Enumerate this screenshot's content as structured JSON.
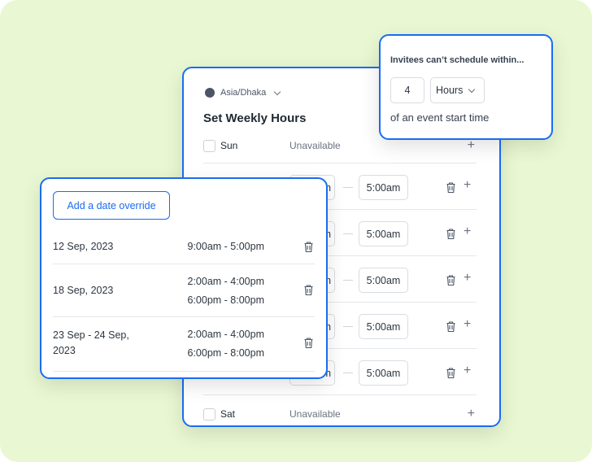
{
  "colors": {
    "accent": "#1a6cf2",
    "background": "#e9f8d2"
  },
  "weekly": {
    "timezone": "Asia/Dhaka",
    "title": "Set Weekly Hours",
    "sun": {
      "day": "Sun",
      "status": "Unavailable"
    },
    "sat": {
      "day": "Sat",
      "status": "Unavailable"
    },
    "rows": [
      {
        "start": "m",
        "end": "5:00am"
      },
      {
        "start": "m",
        "end": "5:00am"
      },
      {
        "start": "m",
        "end": "5:00am"
      },
      {
        "start": "m",
        "end": "5:00am"
      },
      {
        "start": "m",
        "end": "5:00am"
      }
    ]
  },
  "notice": {
    "title": "Invitees can’t schedule within...",
    "amount": "4",
    "unit": "Hours",
    "suffix": "of an event start time"
  },
  "overrides": {
    "button": "Add a date override",
    "items": [
      {
        "date": "12 Sep, 2023",
        "times": [
          "9:00am - 5:00pm"
        ]
      },
      {
        "date": "18 Sep, 2023",
        "times": [
          "2:00am - 4:00pm",
          "6:00pm - 8:00pm"
        ]
      },
      {
        "date": "23 Sep - 24 Sep, 2023",
        "times": [
          "2:00am - 4:00pm",
          "6:00pm - 8:00pm"
        ]
      }
    ]
  }
}
